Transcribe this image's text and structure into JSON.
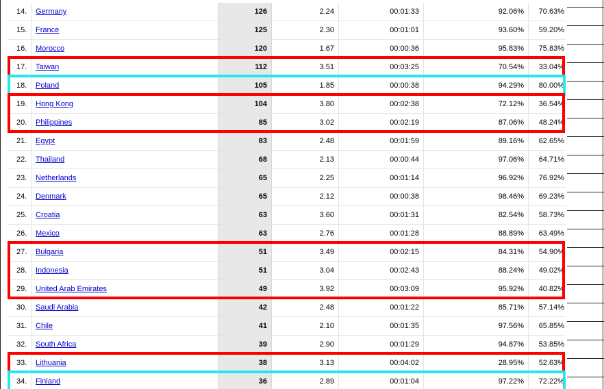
{
  "rows": [
    {
      "rank": "14.",
      "country": "Germany",
      "visits": "126",
      "pages": "2.24",
      "time": "00:01:33",
      "new_visits": "92.06%",
      "bounce": "70.63%"
    },
    {
      "rank": "15.",
      "country": "France",
      "visits": "125",
      "pages": "2.30",
      "time": "00:01:01",
      "new_visits": "93.60%",
      "bounce": "59.20%"
    },
    {
      "rank": "16.",
      "country": "Morocco",
      "visits": "120",
      "pages": "1.67",
      "time": "00:00:36",
      "new_visits": "95.83%",
      "bounce": "75.83%"
    },
    {
      "rank": "17.",
      "country": "Taiwan",
      "visits": "112",
      "pages": "3.51",
      "time": "00:03:25",
      "new_visits": "70.54%",
      "bounce": "33.04%"
    },
    {
      "rank": "18.",
      "country": "Poland",
      "visits": "105",
      "pages": "1.85",
      "time": "00:00:38",
      "new_visits": "94.29%",
      "bounce": "80.00%"
    },
    {
      "rank": "19.",
      "country": "Hong Kong",
      "visits": "104",
      "pages": "3.80",
      "time": "00:02:38",
      "new_visits": "72.12%",
      "bounce": "36.54%"
    },
    {
      "rank": "20.",
      "country": "Philippines",
      "visits": "85",
      "pages": "3.02",
      "time": "00:02:19",
      "new_visits": "87.06%",
      "bounce": "48.24%"
    },
    {
      "rank": "21.",
      "country": "Egypt",
      "visits": "83",
      "pages": "2.48",
      "time": "00:01:59",
      "new_visits": "89.16%",
      "bounce": "62.65%"
    },
    {
      "rank": "22.",
      "country": "Thailand",
      "visits": "68",
      "pages": "2.13",
      "time": "00:00:44",
      "new_visits": "97.06%",
      "bounce": "64.71%"
    },
    {
      "rank": "23.",
      "country": "Netherlands",
      "visits": "65",
      "pages": "2.25",
      "time": "00:01:14",
      "new_visits": "96.92%",
      "bounce": "76.92%"
    },
    {
      "rank": "24.",
      "country": "Denmark",
      "visits": "65",
      "pages": "2.12",
      "time": "00:00:38",
      "new_visits": "98.46%",
      "bounce": "69.23%"
    },
    {
      "rank": "25.",
      "country": "Croatia",
      "visits": "63",
      "pages": "3.60",
      "time": "00:01:31",
      "new_visits": "82.54%",
      "bounce": "58.73%"
    },
    {
      "rank": "26.",
      "country": "Mexico",
      "visits": "63",
      "pages": "2.76",
      "time": "00:01:28",
      "new_visits": "88.89%",
      "bounce": "63.49%"
    },
    {
      "rank": "27.",
      "country": "Bulgaria",
      "visits": "51",
      "pages": "3.49",
      "time": "00:02:15",
      "new_visits": "84.31%",
      "bounce": "54.90%"
    },
    {
      "rank": "28.",
      "country": "Indonesia",
      "visits": "51",
      "pages": "3.04",
      "time": "00:02:43",
      "new_visits": "88.24%",
      "bounce": "49.02%"
    },
    {
      "rank": "29.",
      "country": "United Arab Emirates",
      "visits": "49",
      "pages": "3.92",
      "time": "00:03:09",
      "new_visits": "95.92%",
      "bounce": "40.82%"
    },
    {
      "rank": "30.",
      "country": "Saudi Arabia",
      "visits": "42",
      "pages": "2.48",
      "time": "00:01:22",
      "new_visits": "85.71%",
      "bounce": "57.14%"
    },
    {
      "rank": "31.",
      "country": "Chile",
      "visits": "41",
      "pages": "2.10",
      "time": "00:01:35",
      "new_visits": "97.56%",
      "bounce": "65.85%"
    },
    {
      "rank": "32.",
      "country": "South Africa",
      "visits": "39",
      "pages": "2.90",
      "time": "00:01:29",
      "new_visits": "94.87%",
      "bounce": "53.85%"
    },
    {
      "rank": "33.",
      "country": "Lithuania",
      "visits": "38",
      "pages": "3.13",
      "time": "00:04:02",
      "new_visits": "28.95%",
      "bounce": "52.63%"
    },
    {
      "rank": "34.",
      "country": "Finland",
      "visits": "36",
      "pages": "2.89",
      "time": "00:01:04",
      "new_visits": "97.22%",
      "bounce": "72.22%"
    }
  ],
  "highlights": [
    {
      "color": "red",
      "rows": [
        17
      ]
    },
    {
      "color": "cyan",
      "rows": [
        18
      ]
    },
    {
      "color": "red",
      "rows": [
        19,
        20
      ]
    },
    {
      "color": "red",
      "rows": [
        27,
        28,
        29
      ]
    },
    {
      "color": "red",
      "rows": [
        33
      ]
    },
    {
      "color": "cyan",
      "rows": [
        34
      ]
    }
  ]
}
